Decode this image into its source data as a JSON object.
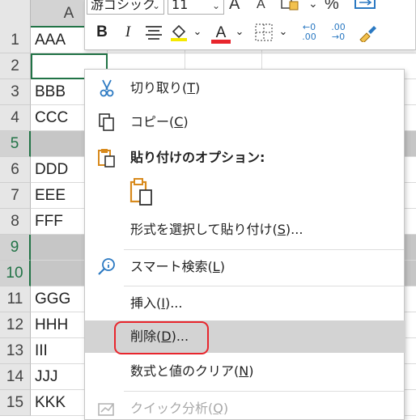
{
  "sheet": {
    "column_header": "A",
    "rows": [
      {
        "num": "1",
        "a": "AAA"
      },
      {
        "num": "2",
        "a": ""
      },
      {
        "num": "3",
        "a": "BBB"
      },
      {
        "num": "4",
        "a": "CCC"
      },
      {
        "num": "5",
        "a": ""
      },
      {
        "num": "6",
        "a": "DDD"
      },
      {
        "num": "7",
        "a": "EEE"
      },
      {
        "num": "8",
        "a": "FFF"
      },
      {
        "num": "9",
        "a": ""
      },
      {
        "num": "10",
        "a": ""
      },
      {
        "num": "11",
        "a": "GGG"
      },
      {
        "num": "12",
        "a": "HHH"
      },
      {
        "num": "13",
        "a": "III"
      },
      {
        "num": "14",
        "a": "JJJ"
      },
      {
        "num": "15",
        "a": "KKK"
      }
    ],
    "selected_rows": [
      "5",
      "9",
      "10"
    ],
    "active_cell_row": "2"
  },
  "mini_toolbar": {
    "font_name": "游ゴシック",
    "font_size": "11",
    "bold": "B",
    "italic": "I",
    "font_color_letter": "A",
    "increase_font_letter": "A",
    "decrease_font_letter": "A",
    "percent": "%",
    "decimal_increase": "←0 .00",
    "decimal_decrease": ".00 →0"
  },
  "context_menu": {
    "cut": {
      "text": "切り取り(",
      "key": "T",
      "tail": ")"
    },
    "copy": {
      "text": "コピー(",
      "key": "C",
      "tail": ")"
    },
    "paste_options_title": "貼り付けのオプション:",
    "paste_special": {
      "text": "形式を選択して貼り付け(",
      "key": "S",
      "tail": ")..."
    },
    "smart_lookup": {
      "text": "スマート検索(",
      "key": "L",
      "tail": ")"
    },
    "insert": {
      "text": "挿入(",
      "key": "I",
      "tail": ")..."
    },
    "delete": {
      "text": "削除(",
      "key": "D",
      "tail": ")..."
    },
    "clear_contents": {
      "text": "数式と値のクリア(",
      "key": "N",
      "tail": ")"
    },
    "quick_analysis": {
      "text": "クイック分析(",
      "key": "Q",
      "tail": ")"
    }
  },
  "colors": {
    "excel_green": "#217346",
    "selection_gray": "#c6c6c6",
    "highlight_red": "#e8262d",
    "icon_orange": "#d88a1d",
    "icon_blue": "#2b79c2"
  }
}
